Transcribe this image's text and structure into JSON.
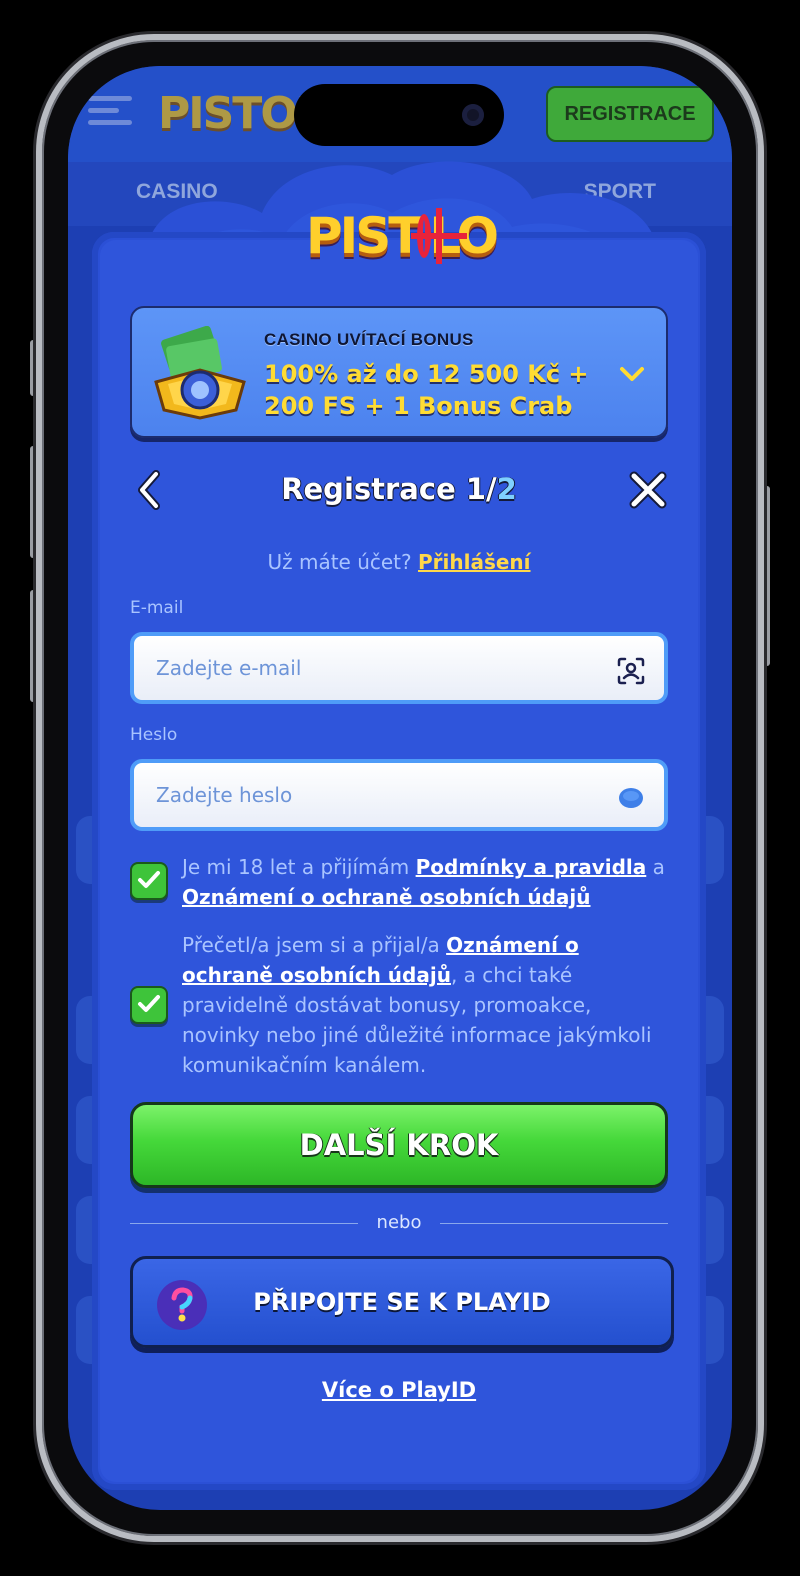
{
  "background": {
    "register_button": "REGISTRACE",
    "nav_left": "CASINO",
    "nav_right": "SPORT"
  },
  "bonus": {
    "subtitle": "CASINO UVÍTACÍ BONUS",
    "title": "100% až do 12 500 Kč + 200 FS + 1 Bonus Crab"
  },
  "modal": {
    "title_main": "Registrace 1/",
    "title_step": "2",
    "login_prompt": "Už máte účet?",
    "login_link": "Přihlášení"
  },
  "form": {
    "email_label": "E-mail",
    "email_placeholder": "Zadejte e-mail",
    "password_label": "Heslo",
    "password_placeholder": "Zadejte heslo"
  },
  "consent1": {
    "text_a": "Je mi 18 let a přijímám ",
    "link_a": "Podmínky a pravidla",
    "text_b": " a ",
    "link_b": "Oznámení o ochraně osobních údajů",
    "checked": true
  },
  "consent2": {
    "text_a": "Přečetl/a jsem si a přijal/a ",
    "link_a": "Oznámení o ochraně osobních údajů",
    "text_b": ", a chci také pravidelně dostávat bonusy, promoakce, novinky nebo jiné důležité informace jakýmkoli komunikačním kanálem.",
    "checked": true
  },
  "actions": {
    "next_step": "DALŠÍ KROK",
    "divider": "nebo",
    "playid": "PŘIPOJTE SE K PLAYID",
    "more_playid": "Více o PlayID"
  },
  "colors": {
    "modal_bg": "#2f55db",
    "cta_green": "#45d83a",
    "link_yellow": "#ffd84a",
    "label_blue": "#a9c4ff"
  }
}
